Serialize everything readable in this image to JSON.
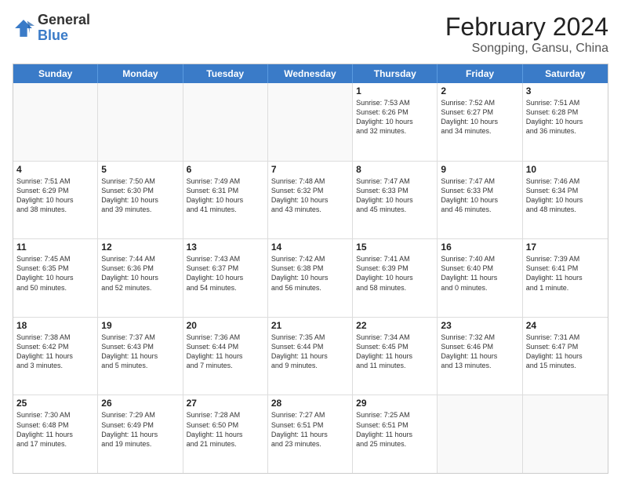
{
  "header": {
    "logo_general": "General",
    "logo_blue": "Blue",
    "title": "February 2024",
    "location": "Songping, Gansu, China"
  },
  "weekdays": [
    "Sunday",
    "Monday",
    "Tuesday",
    "Wednesday",
    "Thursday",
    "Friday",
    "Saturday"
  ],
  "rows": [
    [
      {
        "day": "",
        "info": ""
      },
      {
        "day": "",
        "info": ""
      },
      {
        "day": "",
        "info": ""
      },
      {
        "day": "",
        "info": ""
      },
      {
        "day": "1",
        "info": "Sunrise: 7:53 AM\nSunset: 6:26 PM\nDaylight: 10 hours\nand 32 minutes."
      },
      {
        "day": "2",
        "info": "Sunrise: 7:52 AM\nSunset: 6:27 PM\nDaylight: 10 hours\nand 34 minutes."
      },
      {
        "day": "3",
        "info": "Sunrise: 7:51 AM\nSunset: 6:28 PM\nDaylight: 10 hours\nand 36 minutes."
      }
    ],
    [
      {
        "day": "4",
        "info": "Sunrise: 7:51 AM\nSunset: 6:29 PM\nDaylight: 10 hours\nand 38 minutes."
      },
      {
        "day": "5",
        "info": "Sunrise: 7:50 AM\nSunset: 6:30 PM\nDaylight: 10 hours\nand 39 minutes."
      },
      {
        "day": "6",
        "info": "Sunrise: 7:49 AM\nSunset: 6:31 PM\nDaylight: 10 hours\nand 41 minutes."
      },
      {
        "day": "7",
        "info": "Sunrise: 7:48 AM\nSunset: 6:32 PM\nDaylight: 10 hours\nand 43 minutes."
      },
      {
        "day": "8",
        "info": "Sunrise: 7:47 AM\nSunset: 6:33 PM\nDaylight: 10 hours\nand 45 minutes."
      },
      {
        "day": "9",
        "info": "Sunrise: 7:47 AM\nSunset: 6:33 PM\nDaylight: 10 hours\nand 46 minutes."
      },
      {
        "day": "10",
        "info": "Sunrise: 7:46 AM\nSunset: 6:34 PM\nDaylight: 10 hours\nand 48 minutes."
      }
    ],
    [
      {
        "day": "11",
        "info": "Sunrise: 7:45 AM\nSunset: 6:35 PM\nDaylight: 10 hours\nand 50 minutes."
      },
      {
        "day": "12",
        "info": "Sunrise: 7:44 AM\nSunset: 6:36 PM\nDaylight: 10 hours\nand 52 minutes."
      },
      {
        "day": "13",
        "info": "Sunrise: 7:43 AM\nSunset: 6:37 PM\nDaylight: 10 hours\nand 54 minutes."
      },
      {
        "day": "14",
        "info": "Sunrise: 7:42 AM\nSunset: 6:38 PM\nDaylight: 10 hours\nand 56 minutes."
      },
      {
        "day": "15",
        "info": "Sunrise: 7:41 AM\nSunset: 6:39 PM\nDaylight: 10 hours\nand 58 minutes."
      },
      {
        "day": "16",
        "info": "Sunrise: 7:40 AM\nSunset: 6:40 PM\nDaylight: 11 hours\nand 0 minutes."
      },
      {
        "day": "17",
        "info": "Sunrise: 7:39 AM\nSunset: 6:41 PM\nDaylight: 11 hours\nand 1 minute."
      }
    ],
    [
      {
        "day": "18",
        "info": "Sunrise: 7:38 AM\nSunset: 6:42 PM\nDaylight: 11 hours\nand 3 minutes."
      },
      {
        "day": "19",
        "info": "Sunrise: 7:37 AM\nSunset: 6:43 PM\nDaylight: 11 hours\nand 5 minutes."
      },
      {
        "day": "20",
        "info": "Sunrise: 7:36 AM\nSunset: 6:44 PM\nDaylight: 11 hours\nand 7 minutes."
      },
      {
        "day": "21",
        "info": "Sunrise: 7:35 AM\nSunset: 6:44 PM\nDaylight: 11 hours\nand 9 minutes."
      },
      {
        "day": "22",
        "info": "Sunrise: 7:34 AM\nSunset: 6:45 PM\nDaylight: 11 hours\nand 11 minutes."
      },
      {
        "day": "23",
        "info": "Sunrise: 7:32 AM\nSunset: 6:46 PM\nDaylight: 11 hours\nand 13 minutes."
      },
      {
        "day": "24",
        "info": "Sunrise: 7:31 AM\nSunset: 6:47 PM\nDaylight: 11 hours\nand 15 minutes."
      }
    ],
    [
      {
        "day": "25",
        "info": "Sunrise: 7:30 AM\nSunset: 6:48 PM\nDaylight: 11 hours\nand 17 minutes."
      },
      {
        "day": "26",
        "info": "Sunrise: 7:29 AM\nSunset: 6:49 PM\nDaylight: 11 hours\nand 19 minutes."
      },
      {
        "day": "27",
        "info": "Sunrise: 7:28 AM\nSunset: 6:50 PM\nDaylight: 11 hours\nand 21 minutes."
      },
      {
        "day": "28",
        "info": "Sunrise: 7:27 AM\nSunset: 6:51 PM\nDaylight: 11 hours\nand 23 minutes."
      },
      {
        "day": "29",
        "info": "Sunrise: 7:25 AM\nSunset: 6:51 PM\nDaylight: 11 hours\nand 25 minutes."
      },
      {
        "day": "",
        "info": ""
      },
      {
        "day": "",
        "info": ""
      }
    ]
  ]
}
